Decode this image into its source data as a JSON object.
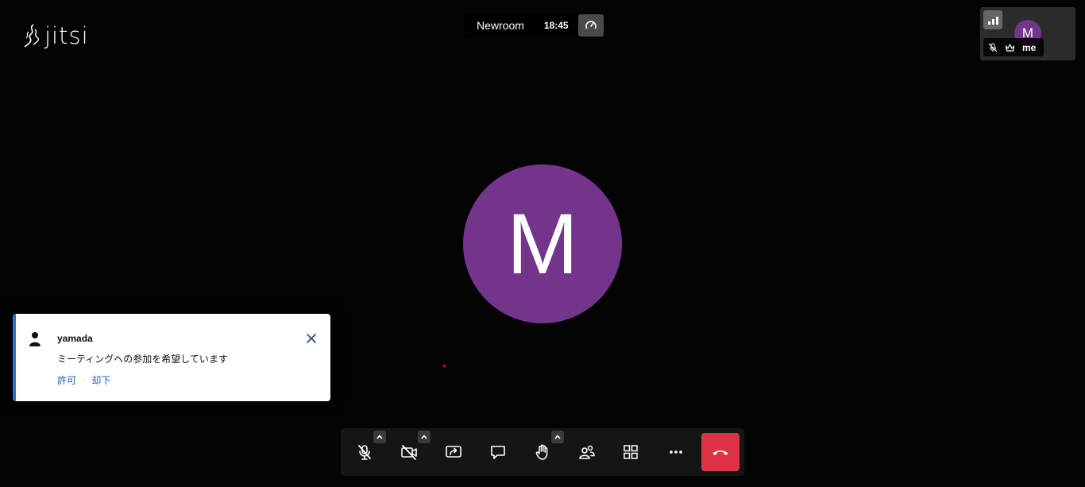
{
  "branding": {
    "logo_text": "jitsi"
  },
  "subject": {
    "room_name": "Newroom",
    "timer": "18:45"
  },
  "filmstrip": {
    "avatar_initial": "M",
    "display_name": "me"
  },
  "main_stage": {
    "avatar_initial": "M",
    "avatar_color": "#74348c"
  },
  "notification": {
    "title": "yamada",
    "description": "ミーティングへの参加を希望しています",
    "allow_label": "許可",
    "separator": "·",
    "reject_label": "却下",
    "accent_color": "#246fe5"
  },
  "toolbar": {
    "items": [
      "microphone-muted-icon",
      "camera-off-icon",
      "screenshare-icon",
      "chat-icon",
      "raise-hand-icon",
      "participants-icon",
      "tile-view-icon",
      "more-icon"
    ],
    "hangup_color": "#dd3344"
  }
}
